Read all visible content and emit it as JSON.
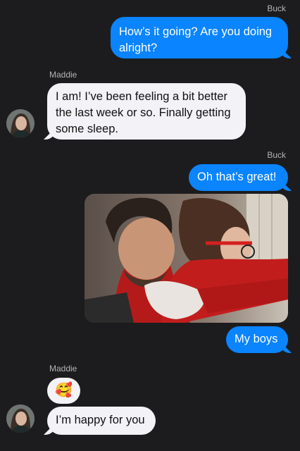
{
  "conversation": {
    "messages": [
      {
        "sender": "Buck",
        "text": "How’s it going? Are you doing alright?"
      },
      {
        "sender": "Maddie",
        "text": "I am! I’ve been feeling a bit better the last week or so. Finally getting some sleep."
      },
      {
        "sender": "Buck",
        "text": "Oh that’s great!"
      },
      {
        "sender": "Buck",
        "attachment": "photo",
        "text": "My boys"
      },
      {
        "sender": "Maddie",
        "emoji": "🥰",
        "text": "I’m happy for you"
      }
    ]
  },
  "colors": {
    "background": "#1c1c1e",
    "outgoing_bubble": "#0a84ff",
    "incoming_bubble": "#f2f2f7",
    "sender_label": "#b4b4b8"
  },
  "icons": {
    "avatar": "maddie-avatar-photo"
  }
}
